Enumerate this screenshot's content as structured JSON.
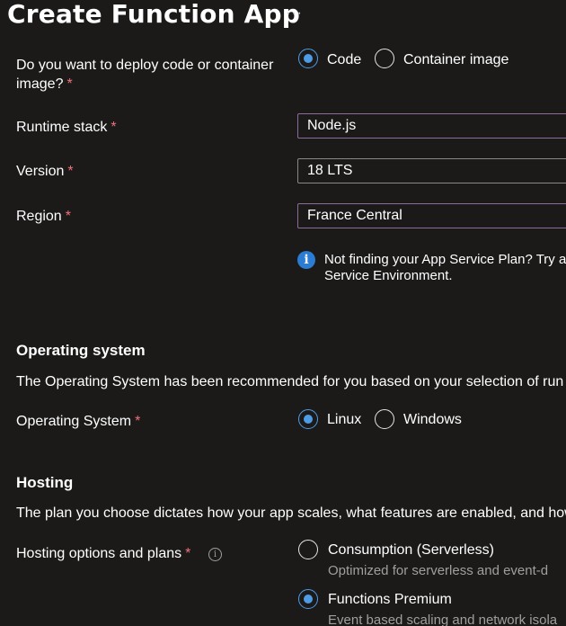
{
  "header": {
    "title": "Create Function App",
    "more_label": "···"
  },
  "deploy": {
    "label_line1": "Do you want to deploy code or container",
    "label_line2": "image?",
    "required": "*",
    "option_code": "Code",
    "option_container": "Container image",
    "selected": "Code"
  },
  "runtime": {
    "label": "Runtime stack",
    "required": "*",
    "value": "Node.js"
  },
  "version": {
    "label": "Version",
    "required": "*",
    "value": "18 LTS"
  },
  "region": {
    "label": "Region",
    "required": "*",
    "value": "France Central"
  },
  "info": {
    "line1": "Not finding your App Service Plan? Try a",
    "line2": "Service Environment."
  },
  "os_section": {
    "heading": "Operating system",
    "description": "The Operating System has been recommended for you based on your selection of run",
    "label": "Operating System",
    "required": "*",
    "option_linux": "Linux",
    "option_windows": "Windows",
    "selected": "Linux"
  },
  "hosting_section": {
    "heading": "Hosting",
    "description": "The plan you choose dictates how your app scales, what features are enabled, and how",
    "label": "Hosting options and plans",
    "required": "*",
    "info_glyph": "i",
    "options": [
      {
        "title": "Consumption (Serverless)",
        "subtitle": "Optimized for serverless and event-d",
        "selected": false
      },
      {
        "title": "Functions Premium",
        "subtitle": "Event based scaling and network isola",
        "selected": true
      }
    ]
  },
  "colors": {
    "background": "#1b1a19",
    "accent": "#4f9ce6",
    "required": "#f1707b",
    "field_border": "#8a6d9a",
    "info": "#2b7cd3"
  }
}
